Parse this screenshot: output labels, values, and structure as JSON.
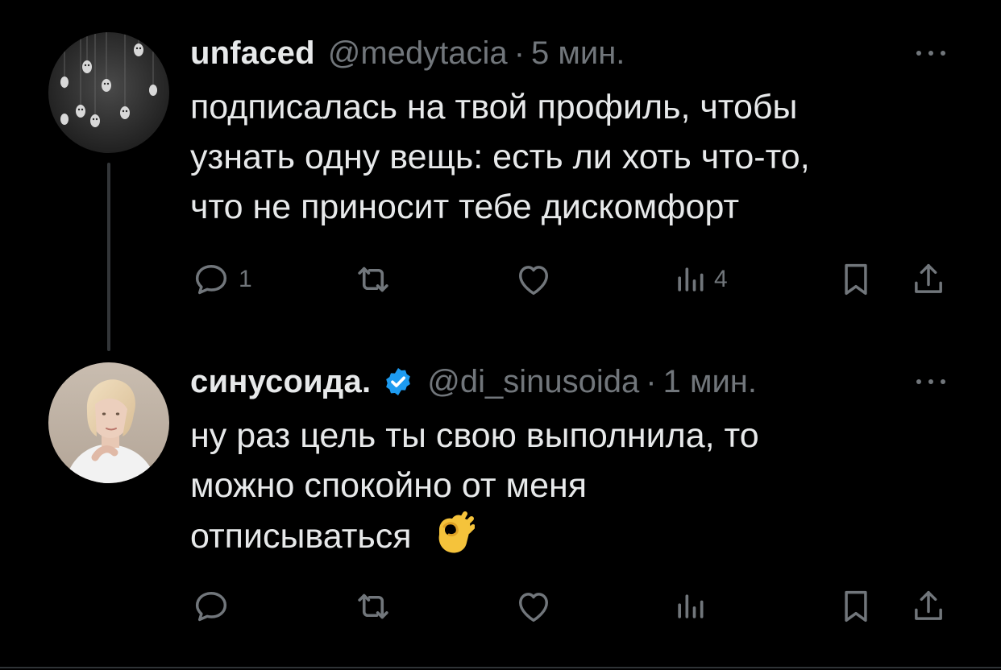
{
  "tweets": [
    {
      "display_name": "unfaced",
      "handle": "@medytacia",
      "separator": "·",
      "time": "5 мин.",
      "verified": false,
      "avatar": "masks-photo",
      "text_lines": [
        "подписалась на твой профиль, чтобы",
        "узнать одну вещь: есть ли хоть что-то,",
        "что не приносит тебе дискомфорт"
      ],
      "replies": "1",
      "retweets": "",
      "likes": "",
      "views": "4"
    },
    {
      "display_name": "синусоида.",
      "handle": "@di_sinusoida",
      "separator": "·",
      "time": "1 мин.",
      "verified": true,
      "avatar": "blonde-woman-photo",
      "text_lines": [
        "ну раз цель ты свою выполнила, то",
        "можно спокойно от меня",
        "отписываться"
      ],
      "emoji": "👌",
      "replies": "",
      "retweets": "",
      "likes": "",
      "views": ""
    }
  ],
  "icons": {
    "reply": "reply-icon",
    "retweet": "retweet-icon",
    "like": "heart-icon",
    "views": "analytics-icon",
    "bookmark": "bookmark-icon",
    "share": "share-icon",
    "more": "more-dots-icon",
    "verified": "verified-badge-icon"
  },
  "colors": {
    "background": "#000000",
    "text": "#e7e9ea",
    "muted": "#71767b",
    "verified": "#1d9bf0",
    "thread_line": "#333639"
  }
}
